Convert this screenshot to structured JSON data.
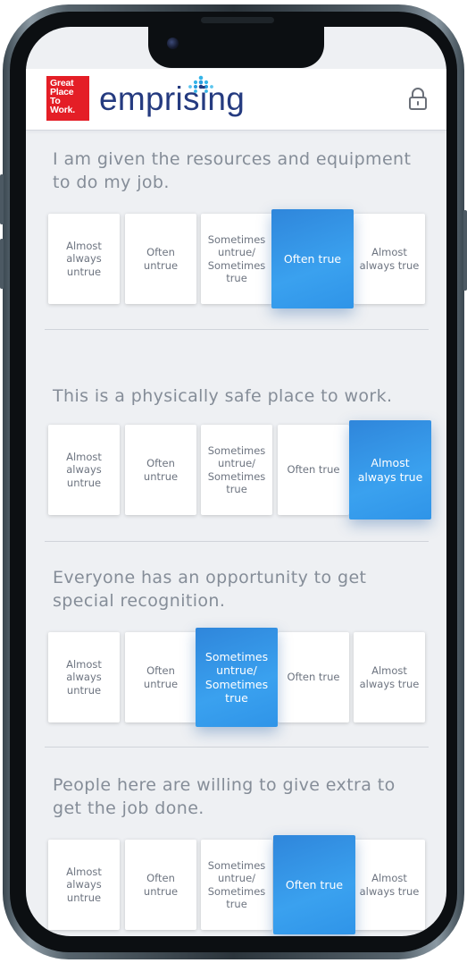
{
  "header": {
    "logo_lines": [
      "Great",
      "Place",
      "To",
      "Work."
    ],
    "brand": "emprising",
    "lock_icon": "lock-icon",
    "brand_color": "#253b80",
    "logo_color": "#e41e26"
  },
  "scale_options": [
    "Almost always untrue",
    "Often untrue",
    "Sometimes untrue/ Sometimes true",
    "Often true",
    "Almost always true"
  ],
  "questions": [
    {
      "text": "I am given the resources and equipment to do my job.",
      "options": [
        "Almost always untrue",
        "Often untrue",
        "Sometimes untrue/ Sometimes true",
        "Often true",
        "Almost always true"
      ],
      "selected_index": 3
    },
    {
      "text": "This is a physically safe place to work.",
      "options": [
        "Almost always untrue",
        "Often untrue",
        "Sometimes untrue/ Sometimes true",
        "Often true",
        "Almost always true"
      ],
      "selected_index": 4
    },
    {
      "text": "Everyone has an opportunity to get special recognition.",
      "options": [
        "Almost always untrue",
        "Often untrue",
        "Sometimes untrue/ Sometimes true",
        "Often true",
        "Almost always true"
      ],
      "selected_index": 2
    },
    {
      "text": "People here are willing to give extra to get the job done.",
      "options": [
        "Almost always untrue",
        "Often untrue",
        "Sometimes untrue/ Sometimes true",
        "Often true",
        "Almost always true"
      ],
      "selected_index": 3
    }
  ],
  "colors": {
    "selected": "#3597e8",
    "question_text": "#858d98",
    "option_text": "#6d7480",
    "screen_bg": "#eef0f3"
  }
}
